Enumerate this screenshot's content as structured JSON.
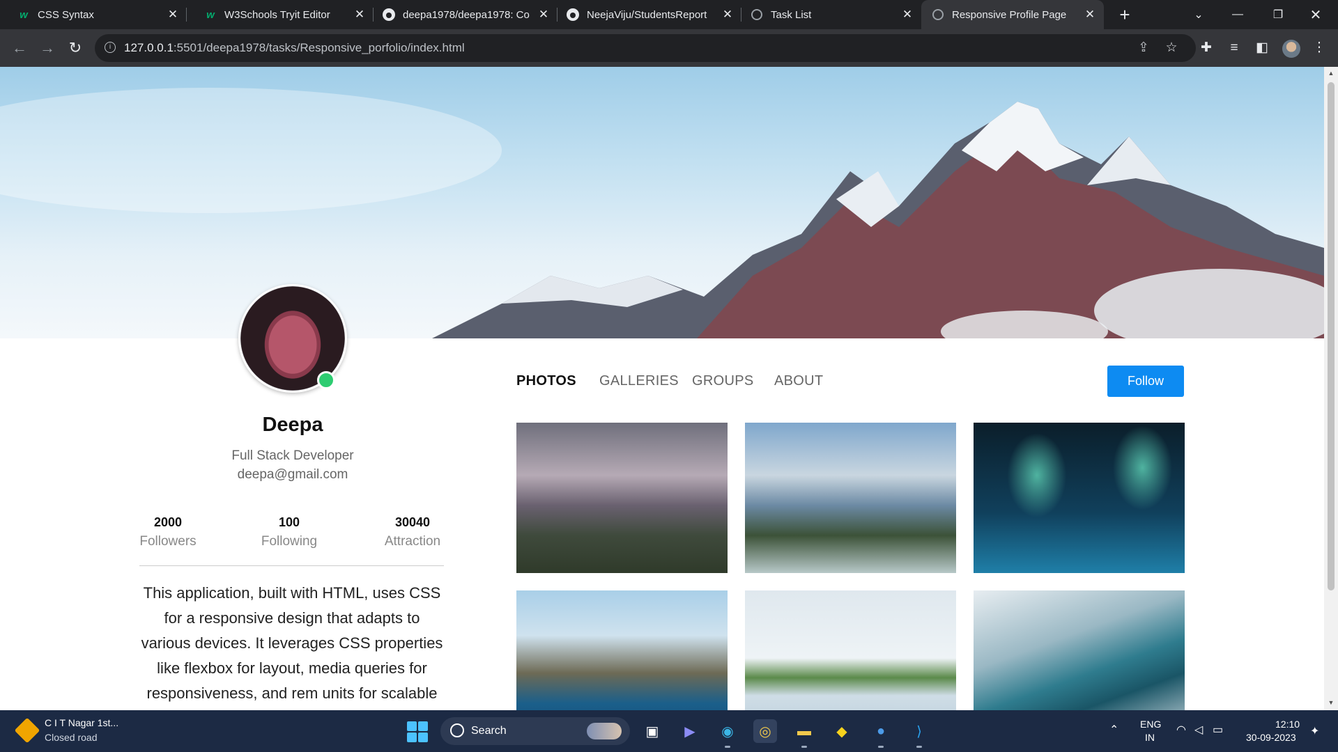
{
  "browser": {
    "tabs": [
      {
        "title": "CSS Syntax",
        "icon": "w3schools-icon",
        "active": false
      },
      {
        "title": "W3Schools Tryit Editor",
        "icon": "w3schools-icon",
        "active": false
      },
      {
        "title": "deepa1978/deepa1978: Co",
        "icon": "github-icon",
        "active": false
      },
      {
        "title": "NeejaViju/StudentsReport",
        "icon": "github-icon",
        "active": false
      },
      {
        "title": "Task List",
        "icon": "globe-icon",
        "active": false
      },
      {
        "title": "Responsive Profile Page",
        "icon": "globe-icon",
        "active": true
      }
    ],
    "url_host": "127.0.0.1",
    "url_rest": ":5501/deepa1978/tasks/Responsive_porfolio/index.html"
  },
  "profile": {
    "name": "Deepa",
    "role": "Full Stack Developer",
    "email": "deepa@gmail.com",
    "online": true,
    "stats": [
      {
        "value": "2000",
        "label": "Followers"
      },
      {
        "value": "100",
        "label": "Following"
      },
      {
        "value": "30040",
        "label": "Attraction"
      }
    ],
    "about_lines": [
      "This application, built with HTML, uses CSS",
      "for a responsive design that adapts to",
      "various devices. It leverages CSS properties",
      "like flexbox for layout, media queries for",
      "responsiveness, and rem units for scalable"
    ]
  },
  "content": {
    "tabs": [
      "PHOTOS",
      "GALLERIES",
      "GROUPS",
      "ABOUT"
    ],
    "active_tab": "PHOTOS",
    "follow_label": "Follow",
    "accent_color": "#0d8bf2"
  },
  "taskbar": {
    "weather_title": "C I T Nagar 1st...",
    "weather_subtitle": "Closed road",
    "search_label": "Search",
    "lang_line1": "ENG",
    "lang_line2": "IN",
    "time": "12:10",
    "date": "30-09-2023"
  }
}
